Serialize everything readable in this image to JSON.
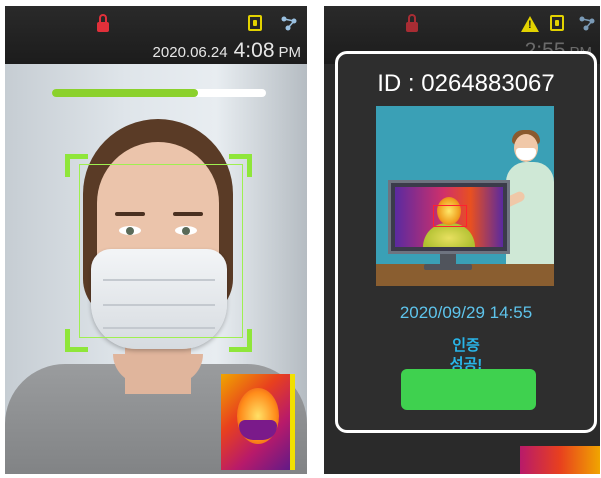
{
  "left_screen": {
    "status": {
      "date": "2020.06.24",
      "time": "4:08",
      "ampm": "PM",
      "icons": [
        "lock-icon",
        "sim-card-icon",
        "network-icon"
      ]
    },
    "scan_progress": 0.68,
    "colors": {
      "progress_fill": "#8bd12c",
      "face_box": "#8fe63a"
    }
  },
  "right_screen": {
    "status": {
      "time_partial": "2:55",
      "ampm": "PM",
      "icons": [
        "lock-icon",
        "warning-icon",
        "sim-card-icon",
        "network-icon"
      ]
    },
    "dialog": {
      "id_text": "ID : 0264883067",
      "datetime": "2020/09/29 14:55",
      "message_line1": "인증",
      "message_line2": "성공!",
      "button_label": ""
    },
    "colors": {
      "datetime": "#5ec4ec",
      "message": "#29b5e8",
      "button": "#3fd14f",
      "border": "#ffffff"
    }
  }
}
